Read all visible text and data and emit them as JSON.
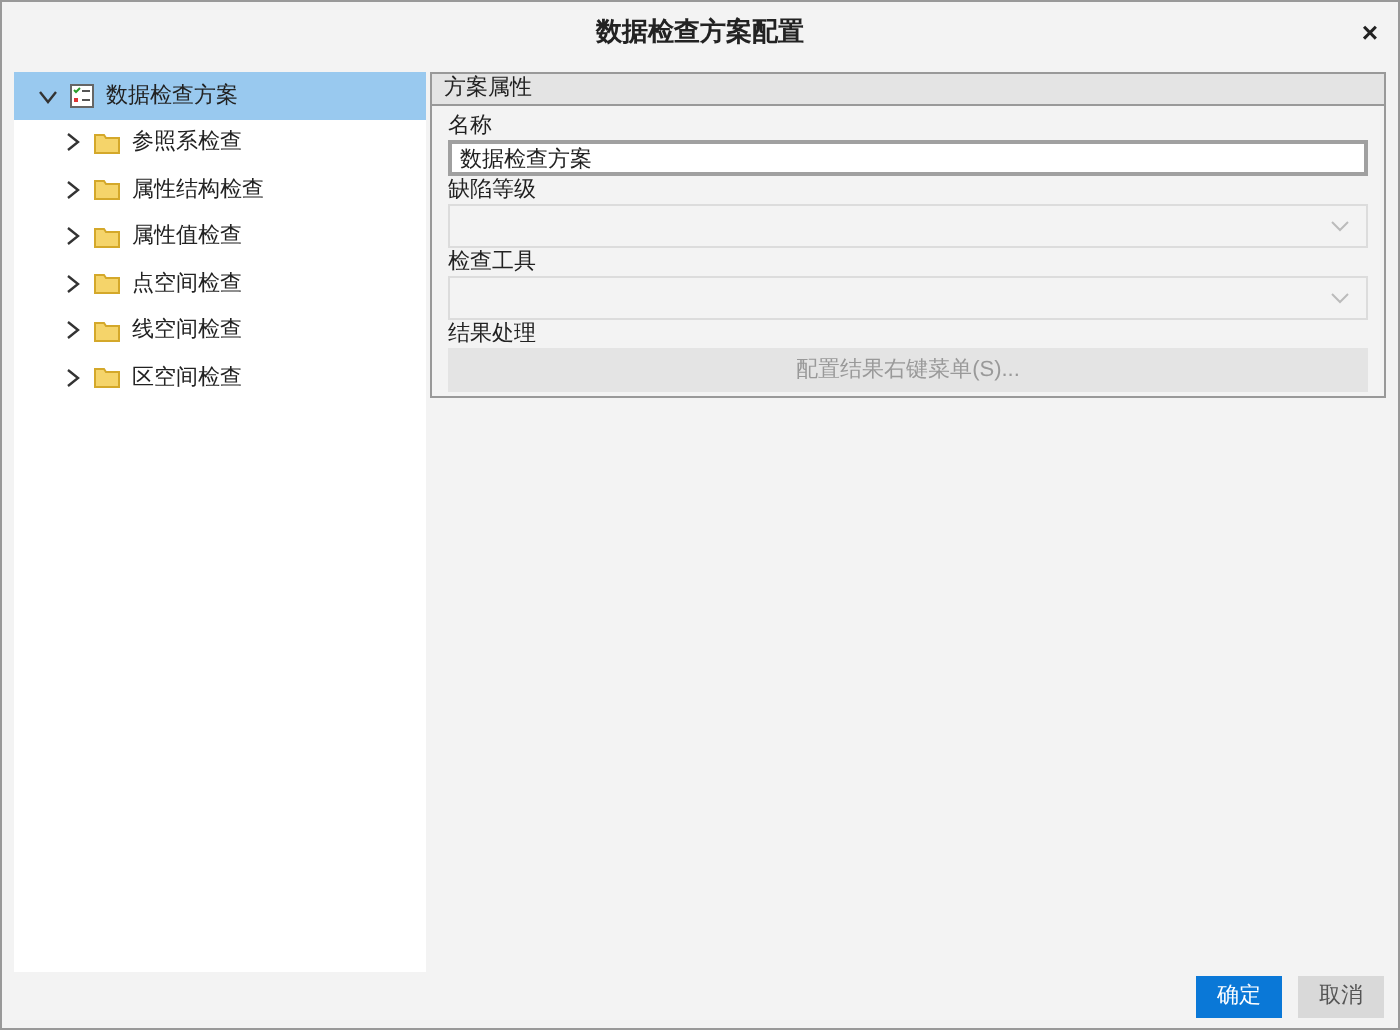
{
  "window": {
    "title": "数据检查方案配置",
    "close": "×"
  },
  "tree": [
    {
      "label": "数据检查方案",
      "kind": "scheme",
      "expanded": true,
      "selected": true,
      "children": [
        {
          "label": "参照系检查",
          "kind": "folder",
          "expanded": false,
          "selected": false
        },
        {
          "label": "属性结构检查",
          "kind": "folder",
          "expanded": false,
          "selected": false
        },
        {
          "label": "属性值检查",
          "kind": "folder",
          "expanded": false,
          "selected": false
        },
        {
          "label": "点空间检查",
          "kind": "folder",
          "expanded": false,
          "selected": false
        },
        {
          "label": "线空间检查",
          "kind": "folder",
          "expanded": false,
          "selected": false
        },
        {
          "label": "区空间检查",
          "kind": "folder",
          "expanded": false,
          "selected": false
        }
      ]
    }
  ],
  "properties": {
    "title": "方案属性",
    "fields": [
      {
        "label": "名称",
        "kind": "text",
        "value": "数据检查方案",
        "disabled": false
      },
      {
        "label": "缺陷等级",
        "kind": "select",
        "disabled": true
      },
      {
        "label": "检查工具",
        "kind": "select",
        "disabled": true
      },
      {
        "label": "结果处理",
        "kind": "button",
        "value": "配置结果右键菜单(S)...",
        "disabled": true
      }
    ]
  },
  "buttons": [
    {
      "label": "确定",
      "kind": "primary"
    },
    {
      "label": "取消",
      "kind": "secondary"
    }
  ]
}
